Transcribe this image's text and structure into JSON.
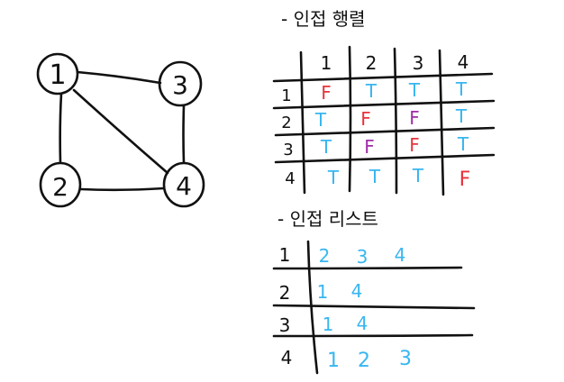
{
  "colors": {
    "ink": "#111111",
    "T": "#38b6f0",
    "F_diag": "#e8323c",
    "F_off": "#a12aa8"
  },
  "graph": {
    "nodes": [
      {
        "id": "1",
        "label": "1"
      },
      {
        "id": "3",
        "label": "3"
      },
      {
        "id": "2",
        "label": "2"
      },
      {
        "id": "4",
        "label": "4"
      }
    ],
    "edges": [
      [
        "1",
        "3"
      ],
      [
        "1",
        "2"
      ],
      [
        "1",
        "4"
      ],
      [
        "3",
        "4"
      ],
      [
        "2",
        "4"
      ]
    ]
  },
  "matrix": {
    "title": "- 인접 행렬",
    "headers": [
      "1",
      "2",
      "3",
      "4"
    ],
    "rows": [
      {
        "label": "1",
        "cells": [
          "F",
          "T",
          "T",
          "T"
        ]
      },
      {
        "label": "2",
        "cells": [
          "T",
          "F",
          "F",
          "T"
        ]
      },
      {
        "label": "3",
        "cells": [
          "T",
          "F",
          "F",
          "T"
        ]
      },
      {
        "label": "4",
        "cells": [
          "T",
          "T",
          "T",
          "F"
        ]
      }
    ]
  },
  "list": {
    "title": "- 인접 리스트",
    "rows": [
      {
        "label": "1",
        "items": [
          "2",
          "3",
          "4"
        ]
      },
      {
        "label": "2",
        "items": [
          "1",
          "4"
        ]
      },
      {
        "label": "3",
        "items": [
          "1",
          "4"
        ]
      },
      {
        "label": "4",
        "items": [
          "1",
          "2",
          "3"
        ]
      }
    ]
  }
}
